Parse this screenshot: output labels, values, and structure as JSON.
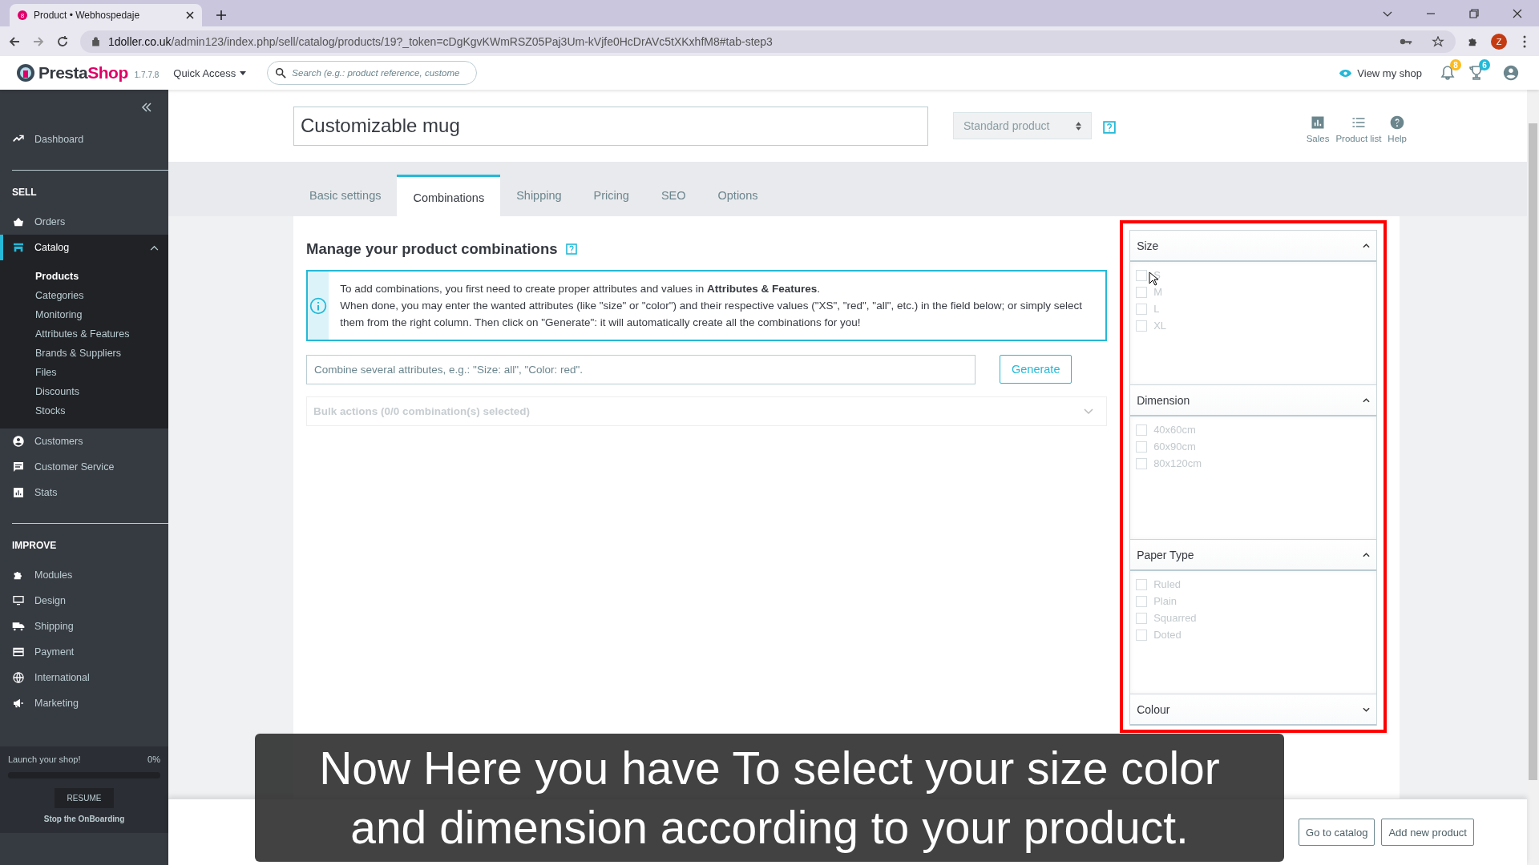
{
  "browser": {
    "tab_title": "Product • Webhospedaje",
    "tab_badge": "8",
    "url_host": "1doller.co.uk",
    "url_path": "/admin123/index.php/sell/catalog/products/19?_token=cDgKgvKWmRSZ05Paj3Um-kVjfe0HcDrAVc5tXKxhfM8#tab-step3",
    "profile_initial": "Z"
  },
  "header": {
    "logo_a": "Presta",
    "logo_b": "Shop",
    "version": "1.7.7.8",
    "quick_access": "Quick Access",
    "search": {
      "placeholder": "Search (e.g.: product reference, custome"
    },
    "view_shop": "View my shop",
    "notifications_count": "8",
    "orders_count": "6"
  },
  "sidebar": {
    "sections": [
      {
        "items": [
          {
            "label": "Dashboard",
            "selected": false
          }
        ]
      },
      {
        "heading": "SELL",
        "items": [
          {
            "label": "Orders",
            "selected": false
          },
          {
            "label": "Catalog",
            "selected": true,
            "expanded": true,
            "children": [
              {
                "label": "Products",
                "selected": true
              },
              {
                "label": "Categories",
                "selected": false
              },
              {
                "label": "Monitoring",
                "selected": false
              },
              {
                "label": "Attributes & Features",
                "selected": false
              },
              {
                "label": "Brands & Suppliers",
                "selected": false
              },
              {
                "label": "Files",
                "selected": false
              },
              {
                "label": "Discounts",
                "selected": false
              },
              {
                "label": "Stocks",
                "selected": false
              }
            ]
          },
          {
            "label": "Customers",
            "selected": false
          },
          {
            "label": "Customer Service",
            "selected": false
          },
          {
            "label": "Stats",
            "selected": false
          }
        ]
      },
      {
        "heading": "IMPROVE",
        "items": [
          {
            "label": "Modules",
            "selected": false
          },
          {
            "label": "Design",
            "selected": false
          },
          {
            "label": "Shipping",
            "selected": false
          },
          {
            "label": "Payment",
            "selected": false
          },
          {
            "label": "International",
            "selected": false
          },
          {
            "label": "Marketing",
            "selected": false
          }
        ]
      }
    ],
    "onboarding": {
      "title": "Launch your shop!",
      "percent": "0%",
      "level": 0,
      "button": "RESUME",
      "stop_link": "Stop the OnBoarding"
    }
  },
  "product": {
    "name": "Customizable mug",
    "type": "Standard product",
    "toolbar": [
      "Sales",
      "Product list",
      "Help"
    ]
  },
  "tabs": [
    {
      "label": "Basic settings",
      "selected": false
    },
    {
      "label": "Combinations",
      "selected": true
    },
    {
      "label": "Shipping",
      "selected": false
    },
    {
      "label": "Pricing",
      "selected": false
    },
    {
      "label": "SEO",
      "selected": false
    },
    {
      "label": "Options",
      "selected": false
    }
  ],
  "combinations": {
    "title": "Manage your product combinations",
    "info": [
      "To add combinations, you first need to create proper attributes and values in **Attributes & Features**.",
      "When done, you may enter the wanted attributes (like \"size\" or \"color\") and their respective values (\"XS\", \"red\", \"all\", etc.) in the field below; or simply select them from the right column. Then click on \"Generate\": it will automatically create all the combinations for you!"
    ],
    "input": {
      "placeholder": "Combine several attributes, e.g.: \"Size: all\", \"Color: red\"."
    },
    "generate": "Generate",
    "bulk_actions": {
      "label": "Bulk actions (0/0 combination(s) selected)",
      "disabled": true
    }
  },
  "attributes": [
    {
      "name": "Size",
      "expanded": true,
      "values": [
        {
          "label": "S",
          "checked": false
        },
        {
          "label": "M",
          "checked": false
        },
        {
          "label": "L",
          "checked": false
        },
        {
          "label": "XL",
          "checked": false
        }
      ]
    },
    {
      "name": "Dimension",
      "expanded": true,
      "values": [
        {
          "label": "40x60cm",
          "checked": false
        },
        {
          "label": "60x90cm",
          "checked": false
        },
        {
          "label": "80x120cm",
          "checked": false
        }
      ]
    },
    {
      "name": "Paper Type",
      "expanded": true,
      "values": [
        {
          "label": "Ruled",
          "checked": false
        },
        {
          "label": "Plain",
          "checked": false
        },
        {
          "label": "Squarred",
          "checked": false
        },
        {
          "label": "Doted",
          "checked": false
        }
      ]
    },
    {
      "name": "Colour",
      "expanded": false
    }
  ],
  "footer": {
    "buttons": [
      "Go to catalog",
      "Add new product"
    ]
  },
  "subtitle": [
    "Now Here you have To select your size color",
    "and dimension according to your product."
  ]
}
